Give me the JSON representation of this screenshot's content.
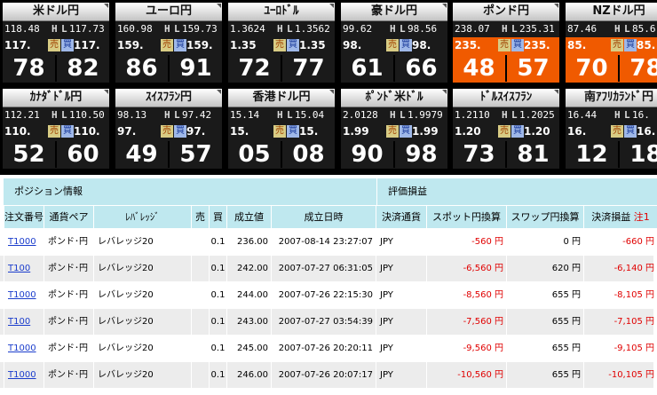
{
  "tiles": [
    {
      "name": "米ドル円",
      "high": "118.48",
      "low": "117.73",
      "sell_prefix": "117.",
      "buy_prefix": "117.",
      "sell_pips": "78",
      "buy_pips": "82",
      "highlight": false
    },
    {
      "name": "ユーロ円",
      "high": "160.98",
      "low": "159.73",
      "sell_prefix": "159.",
      "buy_prefix": "159.",
      "sell_pips": "86",
      "buy_pips": "91",
      "highlight": false
    },
    {
      "name": "ﾕｰﾛﾄﾞﾙ",
      "high": "1.3624",
      "low": "1.3562",
      "sell_prefix": "1.35",
      "buy_prefix": "1.35",
      "sell_pips": "72",
      "buy_pips": "77",
      "highlight": false
    },
    {
      "name": "豪ドル円",
      "high": "99.62",
      "low": "98.56",
      "sell_prefix": "98.",
      "buy_prefix": "98.",
      "sell_pips": "61",
      "buy_pips": "66",
      "highlight": false
    },
    {
      "name": "ポンド円",
      "high": "238.07",
      "low": "235.31",
      "sell_prefix": "235.",
      "buy_prefix": "235.",
      "sell_pips": "48",
      "buy_pips": "57",
      "highlight": true
    },
    {
      "name": "NZドル円",
      "high": "87.46",
      "low": "85.6",
      "sell_prefix": "85.",
      "buy_prefix": "85.",
      "sell_pips": "70",
      "buy_pips": "78",
      "highlight": true
    },
    {
      "name": "ｶﾅﾀﾞﾄﾞﾙ円",
      "high": "112.21",
      "low": "110.50",
      "sell_prefix": "110.",
      "buy_prefix": "110.",
      "sell_pips": "52",
      "buy_pips": "60",
      "highlight": false
    },
    {
      "name": "ｽｲｽﾌﾗﾝ円",
      "high": "98.13",
      "low": "97.42",
      "sell_prefix": "97.",
      "buy_prefix": "97.",
      "sell_pips": "49",
      "buy_pips": "57",
      "highlight": false
    },
    {
      "name": "香港ドル円",
      "high": "15.14",
      "low": "15.04",
      "sell_prefix": "15.",
      "buy_prefix": "15.",
      "sell_pips": "05",
      "buy_pips": "08",
      "highlight": false
    },
    {
      "name": "ﾎﾟﾝﾄﾞ米ﾄﾞﾙ",
      "high": "2.0128",
      "low": "1.9979",
      "sell_prefix": "1.99",
      "buy_prefix": "1.99",
      "sell_pips": "90",
      "buy_pips": "98",
      "highlight": false
    },
    {
      "name": "ﾄﾞﾙｽｲｽﾌﾗﾝ",
      "high": "1.2110",
      "low": "1.2025",
      "sell_prefix": "1.20",
      "buy_prefix": "1.20",
      "sell_pips": "73",
      "buy_pips": "81",
      "highlight": false
    },
    {
      "name": "南ｱﾌﾘｶﾗﾝﾄﾞ円",
      "high": "16.44",
      "low": "16.",
      "sell_prefix": "16.",
      "buy_prefix": "16.",
      "sell_pips": "12",
      "buy_pips": "18",
      "highlight": false
    }
  ],
  "labels": {
    "high": "H",
    "low": "L",
    "sell": "売",
    "buy": "買"
  },
  "positions": {
    "section_title": "ポジション情報",
    "valuation_title": "評価損益",
    "columns": [
      "注文番号",
      "通貨ペア",
      "ﾚﾊﾞﾚｯｼﾞ",
      "売",
      "買",
      "成立値",
      "成立日時",
      "決済通貨",
      "スポット円換算",
      "スワップ円換算",
      "決済損益"
    ],
    "note_label": "注1",
    "rows": [
      {
        "order": "T1000",
        "pair": "ポンド･円",
        "leverage": "レバレッジ20",
        "sell": "",
        "buy": "0.1",
        "price": "236.00",
        "datetime": "2007-08-14 23:27:07",
        "currency": "JPY",
        "spot": "-560 円",
        "swap": "0 円",
        "pl": "-660 円"
      },
      {
        "order": "T100",
        "pair": "ポンド･円",
        "leverage": "レバレッジ20",
        "sell": "",
        "buy": "0.1",
        "price": "242.00",
        "datetime": "2007-07-27 06:31:05",
        "currency": "JPY",
        "spot": "-6,560 円",
        "swap": "620 円",
        "pl": "-6,140 円"
      },
      {
        "order": "T1000",
        "pair": "ポンド･円",
        "leverage": "レバレッジ20",
        "sell": "",
        "buy": "0.1",
        "price": "244.00",
        "datetime": "2007-07-26 22:15:30",
        "currency": "JPY",
        "spot": "-8,560 円",
        "swap": "655 円",
        "pl": "-8,105 円"
      },
      {
        "order": "T100",
        "pair": "ポンド･円",
        "leverage": "レバレッジ20",
        "sell": "",
        "buy": "0.1",
        "price": "243.00",
        "datetime": "2007-07-27 03:54:39",
        "currency": "JPY",
        "spot": "-7,560 円",
        "swap": "655 円",
        "pl": "-7,105 円"
      },
      {
        "order": "T1000",
        "pair": "ポンド･円",
        "leverage": "レバレッジ20",
        "sell": "",
        "buy": "0.1",
        "price": "245.00",
        "datetime": "2007-07-26 20:20:11",
        "currency": "JPY",
        "spot": "-9,560 円",
        "swap": "655 円",
        "pl": "-9,105 円"
      },
      {
        "order": "T1000",
        "pair": "ポンド･円",
        "leverage": "レバレッジ20",
        "sell": "",
        "buy": "0.1",
        "price": "246.00",
        "datetime": "2007-07-26 20:07:17",
        "currency": "JPY",
        "spot": "-10,560 円",
        "swap": "655 円",
        "pl": "-10,105 円"
      }
    ]
  },
  "colors": {
    "highlight_tile": "#f05a00",
    "header_bg": "#bfe8ef",
    "negative": "#e00000",
    "link": "#1a3ccc"
  }
}
